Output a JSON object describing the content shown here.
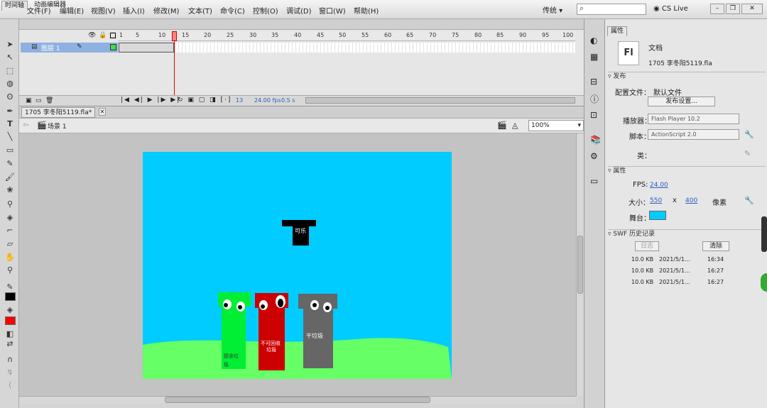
{
  "app": {
    "logo": "Fl"
  },
  "menu": [
    "文件(F)",
    "编辑(E)",
    "视图(V)",
    "插入(I)",
    "修改(M)",
    "文本(T)",
    "命令(C)",
    "控制(O)",
    "调试(D)",
    "窗口(W)",
    "帮助(H)"
  ],
  "titlebar": {
    "preset": "传统 ▾",
    "search_placeholder": "",
    "cslive": "CS Live"
  },
  "timeline": {
    "tabs": [
      "时间轴",
      "动画编辑器"
    ],
    "layer_name": "图层 1",
    "ruler_ticks": [
      "1",
      "5",
      "10",
      "15",
      "20",
      "25",
      "30",
      "35",
      "40",
      "45",
      "50",
      "55",
      "60",
      "65",
      "70",
      "75",
      "80",
      "85",
      "90",
      "95",
      "100"
    ],
    "current_frame": "13",
    "fps": "24.00 fps",
    "time": "0.5 s"
  },
  "document": {
    "tab_name": "1705 李冬阳5119.fla*",
    "scene": "场景 1",
    "zoom": "100%"
  },
  "stage": {
    "colors": {
      "sky": "#00ccff",
      "grass": "#66ff66",
      "green_bin": "#00ee33",
      "red_bin": "#cc0000",
      "gray_bin": "#666666",
      "cola": "#000000"
    },
    "cola_label": "可乐",
    "bins": [
      {
        "label": "厨余垃\n圾"
      },
      {
        "label": "不可回收\n垃圾"
      },
      {
        "label": "干垃圾"
      }
    ]
  },
  "properties": {
    "tab": "属性",
    "doc_type": "文档",
    "file_name": "1705 李冬阳5119.fla",
    "publish_section": "发布",
    "profile_label": "配置文件：",
    "profile_value": "默认文件",
    "publish_settings": "发布设置...",
    "player_label": "播放器：",
    "player_value": "Flash Player 10.2",
    "script_label": "脚本：",
    "script_value": "ActionScript 2.0",
    "class_label": "类：",
    "props_section": "属性",
    "fps_label": "FPS:",
    "fps_value": "24.00",
    "size_label": "大小：",
    "width": "550",
    "x_sep": "x",
    "height": "400",
    "unit": "像素",
    "stage_label": "舞台：",
    "stage_color": "#00ccff",
    "swf_section": "SWF 历史记录",
    "log_button": "日志",
    "clear_button": "清除",
    "history": [
      {
        "size": "10.0 KB",
        "date": "2021/5/1...",
        "time": "16:34"
      },
      {
        "size": "10.0 KB",
        "date": "2021/5/1...",
        "time": "16:27"
      },
      {
        "size": "10.0 KB",
        "date": "2021/5/1...",
        "time": "16:27"
      }
    ]
  }
}
